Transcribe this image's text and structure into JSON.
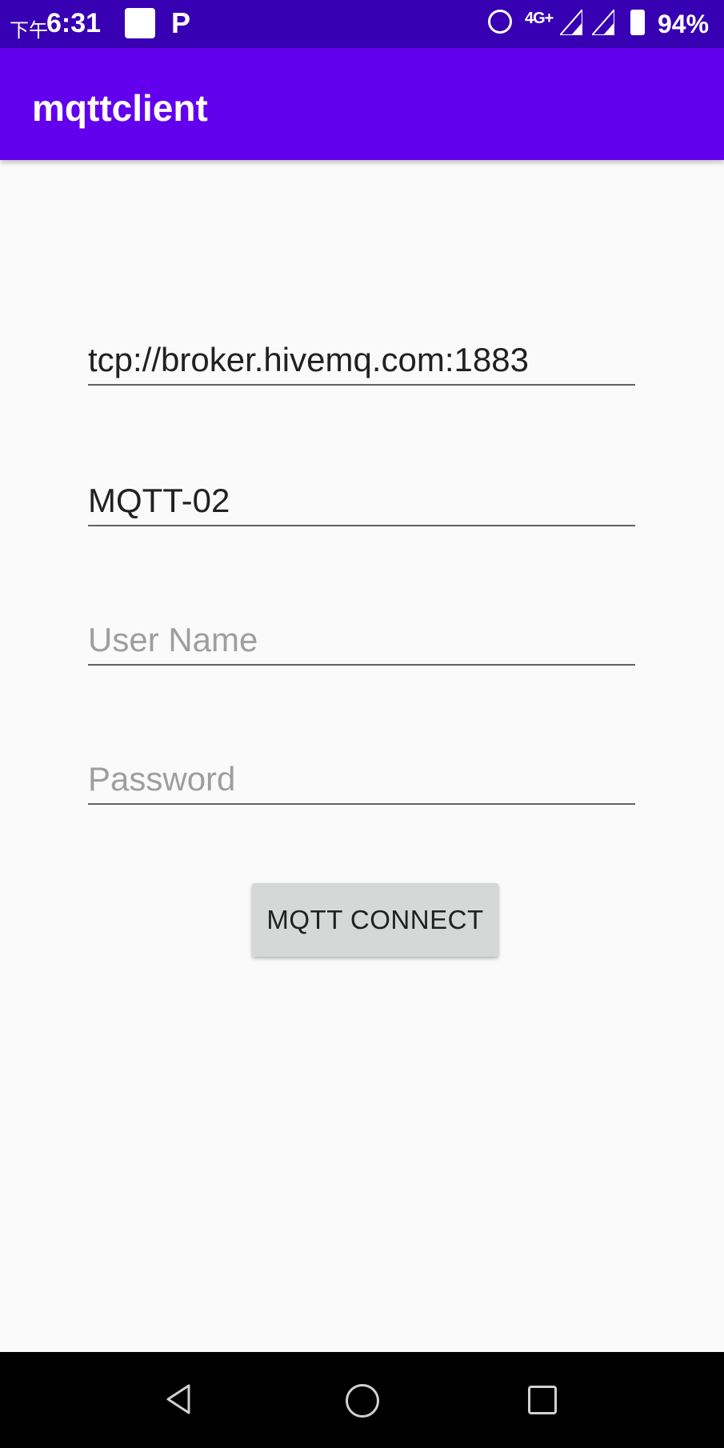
{
  "status_bar": {
    "time_prefix": "下午",
    "time": "6:31",
    "p_icon_text": "P",
    "network": "4G+",
    "battery": "94%"
  },
  "app_bar": {
    "title": "mqttclient"
  },
  "form": {
    "broker_url": {
      "value": "tcp://broker.hivemq.com:1883",
      "placeholder": ""
    },
    "client_id": {
      "value": "MQTT-02",
      "placeholder": ""
    },
    "username": {
      "value": "",
      "placeholder": "User Name"
    },
    "password": {
      "value": "",
      "placeholder": "Password"
    },
    "connect_label": "MQTT CONNECT"
  }
}
